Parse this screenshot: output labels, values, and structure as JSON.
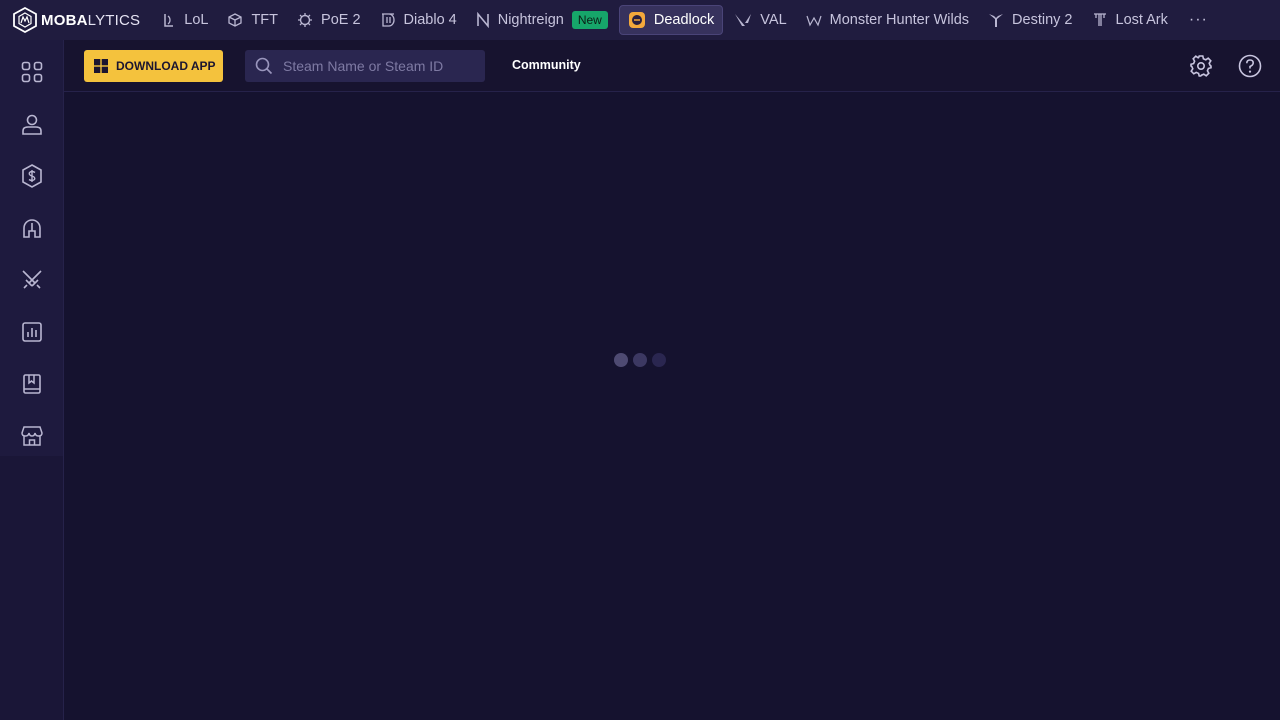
{
  "brand": {
    "bold": "MOBA",
    "light": "LYTICS"
  },
  "games": [
    {
      "label": "LoL",
      "icon": "lol-icon"
    },
    {
      "label": "TFT",
      "icon": "tft-icon"
    },
    {
      "label": "PoE 2",
      "icon": "poe2-icon"
    },
    {
      "label": "Diablo 4",
      "icon": "diablo4-icon"
    },
    {
      "label": "Nightreign",
      "icon": "nightreign-icon",
      "badge": "New"
    },
    {
      "label": "Deadlock",
      "icon": "deadlock-icon",
      "active": true
    },
    {
      "label": "VAL",
      "icon": "valorant-icon"
    },
    {
      "label": "Monster Hunter Wilds",
      "icon": "mhw-icon"
    },
    {
      "label": "Destiny 2",
      "icon": "destiny2-icon"
    },
    {
      "label": "Lost Ark",
      "icon": "lostark-icon"
    }
  ],
  "more_label": "···",
  "sidebar": {
    "items": [
      {
        "icon": "grid-icon"
      },
      {
        "icon": "profile-icon"
      },
      {
        "icon": "currency-shield-icon"
      },
      {
        "icon": "helmet-icon"
      },
      {
        "icon": "crossed-swords-icon"
      },
      {
        "icon": "stats-chart-icon"
      },
      {
        "icon": "book-icon"
      },
      {
        "icon": "shop-icon"
      }
    ]
  },
  "toolbar": {
    "download_label": "DOWNLOAD APP",
    "search_placeholder": "Steam Name or Steam ID",
    "community_label": "Community"
  },
  "colors": {
    "background": "#15122f",
    "nav": "#201c3f",
    "accent": "#f4c23d",
    "badge_new": "#16a66a"
  }
}
